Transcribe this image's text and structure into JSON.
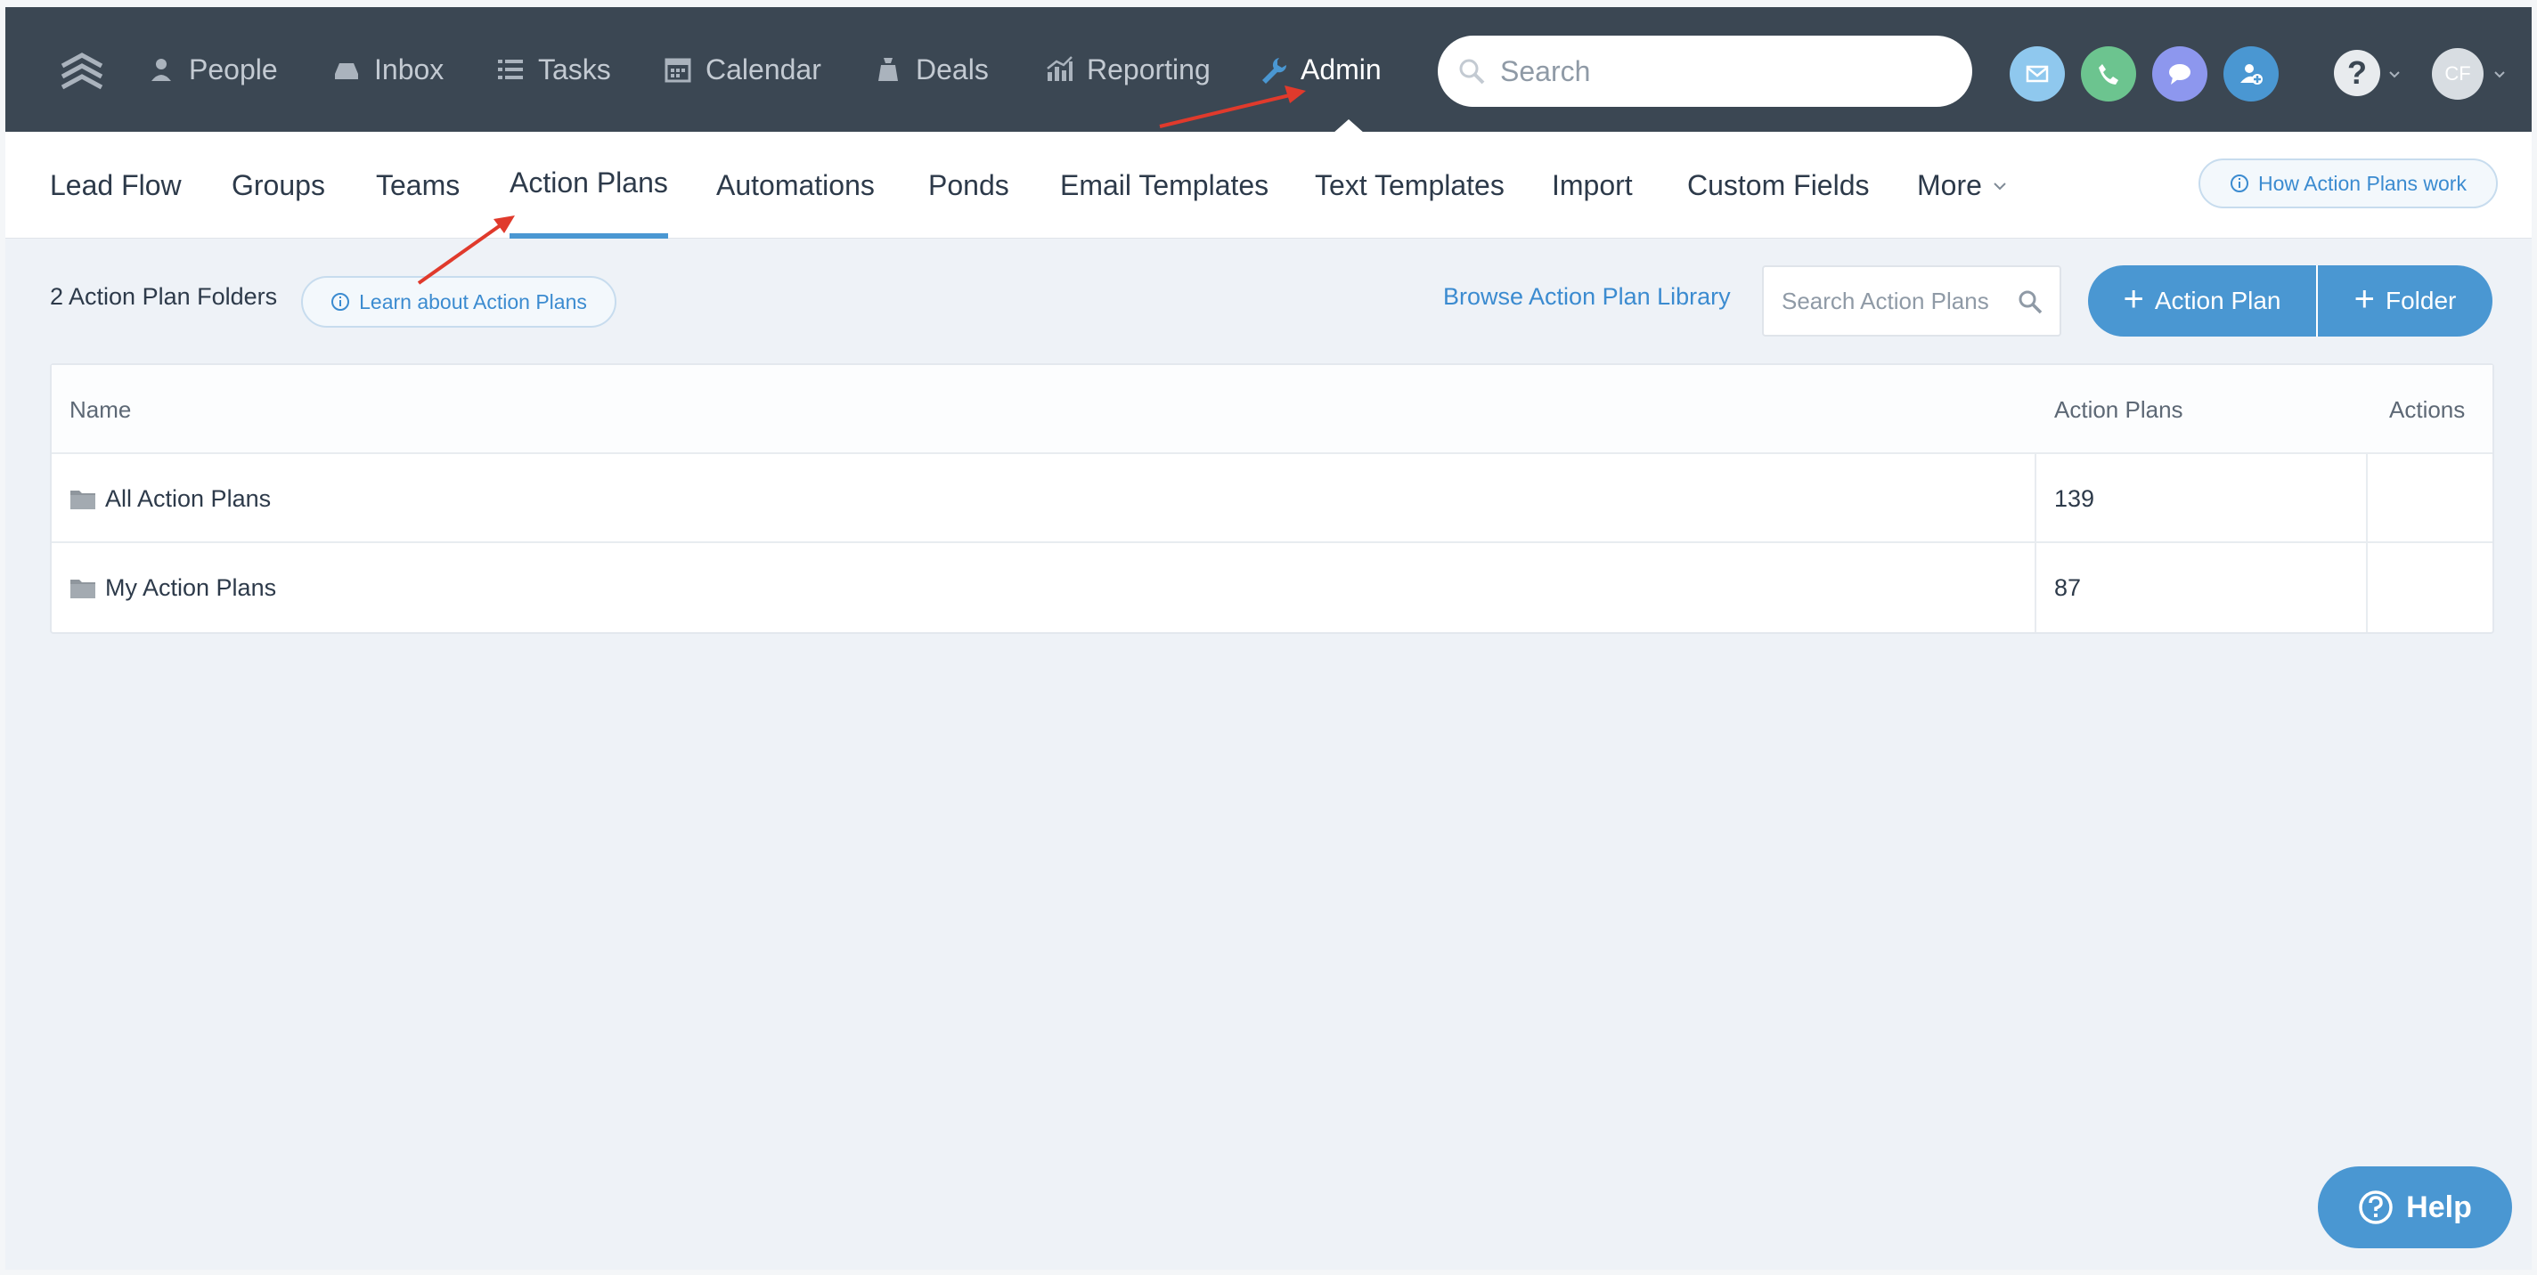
{
  "topnav": {
    "items": [
      {
        "label": "People",
        "icon": "person-icon"
      },
      {
        "label": "Inbox",
        "icon": "inbox-icon"
      },
      {
        "label": "Tasks",
        "icon": "list-icon"
      },
      {
        "label": "Calendar",
        "icon": "calendar-icon"
      },
      {
        "label": "Deals",
        "icon": "deal-bag-icon"
      },
      {
        "label": "Reporting",
        "icon": "chart-icon"
      },
      {
        "label": "Admin",
        "icon": "wrench-icon",
        "active": true
      }
    ],
    "search_placeholder": "Search",
    "avatar_initials": "CF",
    "help_glyph": "?"
  },
  "subnav": {
    "tabs": [
      {
        "label": "Lead Flow"
      },
      {
        "label": "Groups"
      },
      {
        "label": "Teams"
      },
      {
        "label": "Action Plans",
        "active": true
      },
      {
        "label": "Automations"
      },
      {
        "label": "Ponds"
      },
      {
        "label": "Email Templates"
      },
      {
        "label": "Text Templates"
      },
      {
        "label": "Import"
      },
      {
        "label": "Custom Fields"
      },
      {
        "label": "More"
      }
    ],
    "how_label": "How Action Plans work"
  },
  "toolbar": {
    "folders_count": "2 Action Plan Folders",
    "learn_label": "Learn about Action Plans",
    "browse_label": "Browse Action Plan Library",
    "search_placeholder": "Search Action Plans",
    "add_plan_label": "Action Plan",
    "add_folder_label": "Folder"
  },
  "table": {
    "columns": [
      "Name",
      "Action Plans",
      "Actions"
    ],
    "rows": [
      {
        "name": "All Action Plans",
        "count": "139"
      },
      {
        "name": "My Action Plans",
        "count": "87"
      }
    ]
  },
  "help_button": {
    "label": "Help"
  },
  "colors": {
    "nav_bg": "#3b4753",
    "accent": "#4a97d2",
    "page_bg": "#eef2f7",
    "annotation_arrow": "#e03a2c"
  }
}
